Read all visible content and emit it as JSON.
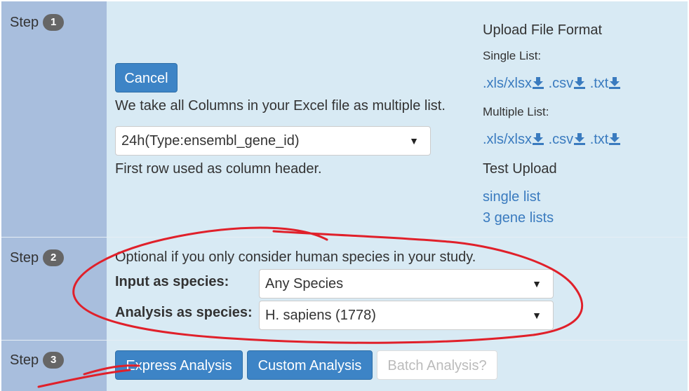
{
  "step_label": "Step",
  "steps": [
    {
      "number": "1"
    },
    {
      "number": "2"
    },
    {
      "number": "3"
    }
  ],
  "step1": {
    "cancel_label": "Cancel",
    "description": "We take all Columns in your Excel file as multiple list.",
    "column_select_value": "24h(Type:ensembl_gene_id)",
    "header_note": "First row used as column header."
  },
  "upload_format": {
    "title": "Upload File Format",
    "single_list_label": "Single List:",
    "multiple_list_label": "Multiple List:",
    "formats": [
      ".xls/xlsx",
      ".csv",
      ".txt"
    ],
    "test_upload_title": "Test Upload",
    "test_links": [
      "single list",
      "3 gene lists"
    ]
  },
  "step2": {
    "note": "Optional if you only consider human species in your study.",
    "input_species_label": "Input as species:",
    "input_species_value": "Any Species",
    "analysis_species_label": "Analysis as species:",
    "analysis_species_value": "H. sapiens (1778)"
  },
  "step3": {
    "express_label": "Express Analysis",
    "custom_label": "Custom Analysis",
    "batch_label": "Batch Analysis?"
  },
  "colors": {
    "label_column": "#a8bedd",
    "content_column": "#d8eaf4",
    "primary_button": "#3d84c6",
    "link": "#3a7bbf",
    "annotation": "#e0202a"
  }
}
